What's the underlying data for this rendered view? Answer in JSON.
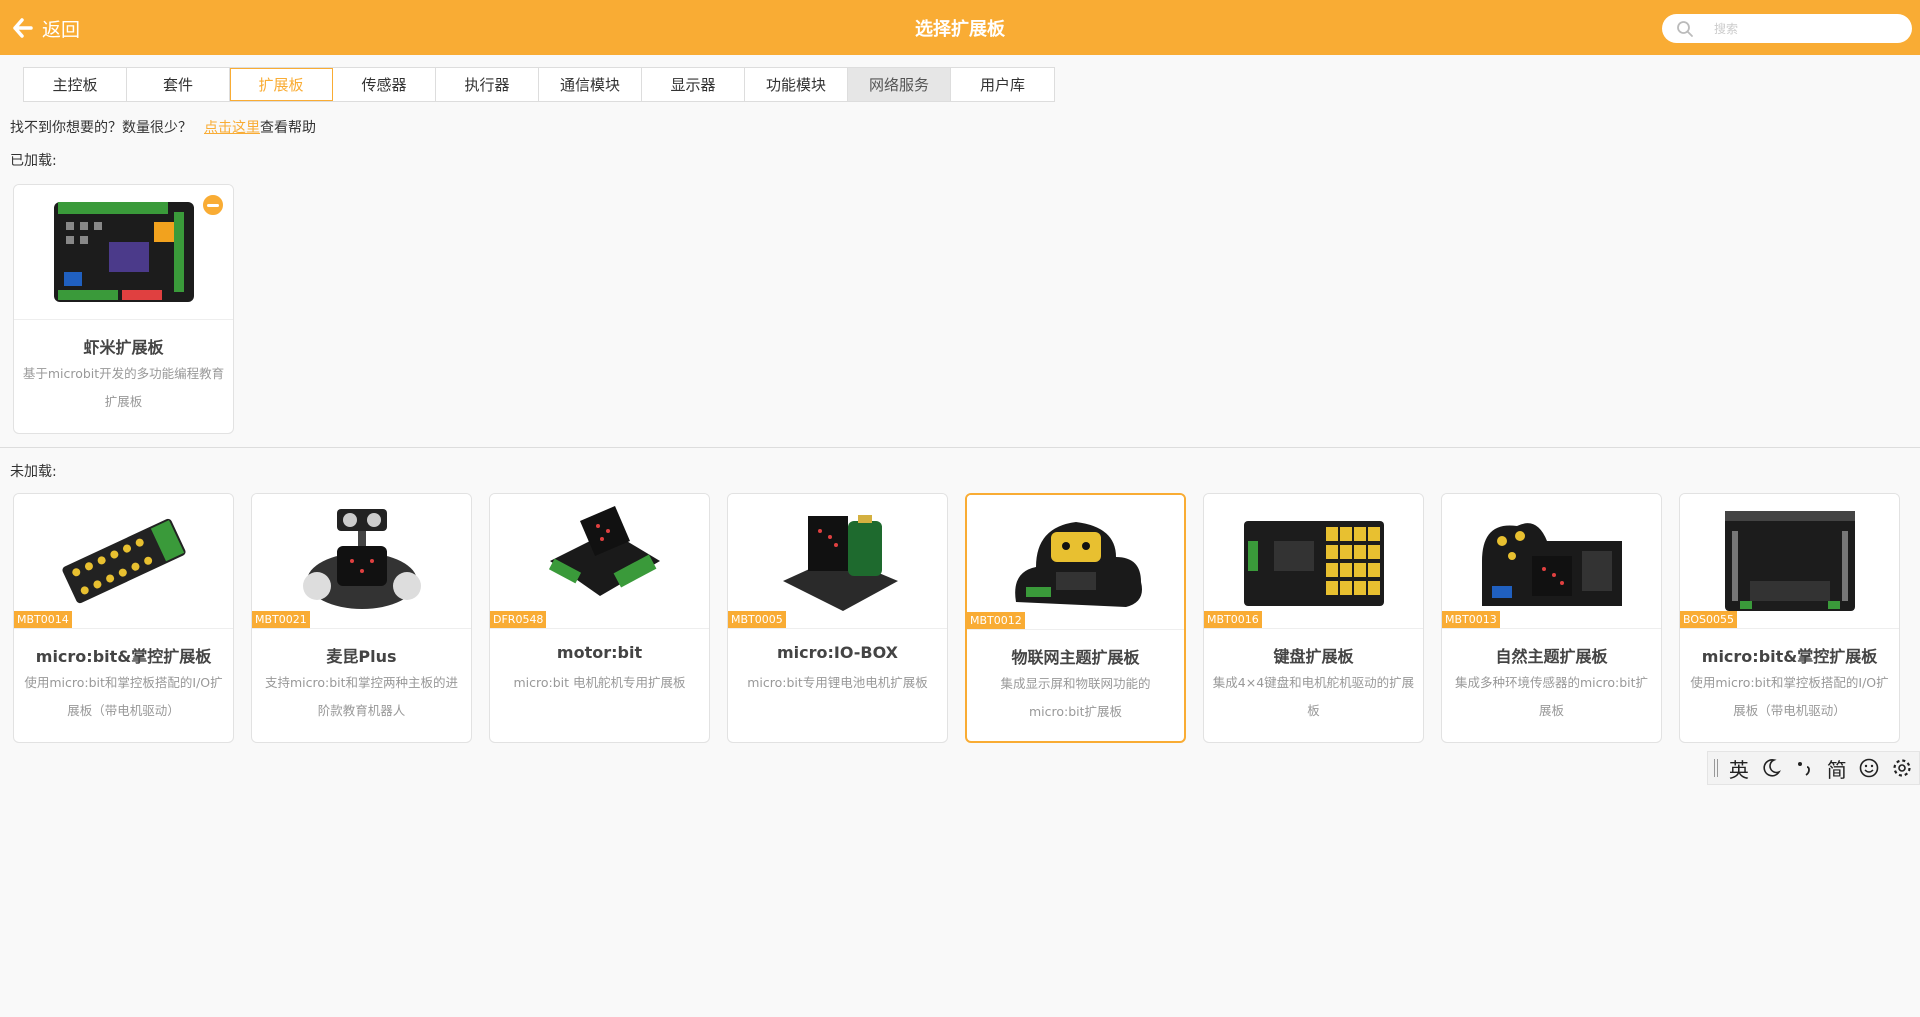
{
  "header": {
    "back_label": "返回",
    "title": "选择扩展板",
    "search_placeholder": "搜索",
    "search_value": ""
  },
  "tabs": [
    {
      "label": "主控板"
    },
    {
      "label": "套件"
    },
    {
      "label": "扩展板"
    },
    {
      "label": "传感器"
    },
    {
      "label": "执行器"
    },
    {
      "label": "通信模块"
    },
    {
      "label": "显示器"
    },
    {
      "label": "功能模块"
    },
    {
      "label": "网络服务"
    },
    {
      "label": "用户库"
    }
  ],
  "active_tab": "扩展板",
  "help": {
    "text": "找不到你想要的？数量很少？",
    "link": "点击这里",
    "suffix": "查看帮助"
  },
  "loaded": {
    "label": "已加载:",
    "items": [
      {
        "title": "虾米扩展板",
        "desc": "基于microbit开发的多功能编程教育扩展板",
        "icon": "board-image"
      }
    ]
  },
  "unloaded": {
    "label": "未加载:",
    "items": [
      {
        "sku": "MBT0014",
        "title": "micro:bit&掌控扩展板",
        "desc": "使用micro:bit和掌控板搭配的I/O扩展板（带电机驱动）"
      },
      {
        "sku": "MBT0021",
        "title": "麦昆Plus",
        "desc": "支持micro:bit和掌控两种主板的进阶款教育机器人"
      },
      {
        "sku": "DFR0548",
        "title": "motor:bit",
        "desc": "micro:bit 电机舵机专用扩展板"
      },
      {
        "sku": "MBT0005",
        "title": "micro:IO-BOX",
        "desc": "micro:bit专用锂电池电机扩展板"
      },
      {
        "sku": "MBT0012",
        "title": "物联网主题扩展板",
        "desc": "集成显示屏和物联网功能的micro:bit扩展板"
      },
      {
        "sku": "MBT0016",
        "title": "键盘扩展板",
        "desc": "集成4×4键盘和电机舵机驱动的扩展板"
      },
      {
        "sku": "MBT0013",
        "title": "自然主题扩展板",
        "desc": "集成多种环境传感器的micro:bit扩展板"
      },
      {
        "sku": "BOS0055",
        "title": "micro:bit&掌控扩展板",
        "desc": "使用micro:bit和掌控板搭配的I/O扩展板（带电机驱动）"
      }
    ]
  },
  "ime": {
    "lang": "英",
    "mode": "简"
  },
  "colors": {
    "accent": "#f9ac34",
    "grey_tab": "#e6e6e6"
  }
}
